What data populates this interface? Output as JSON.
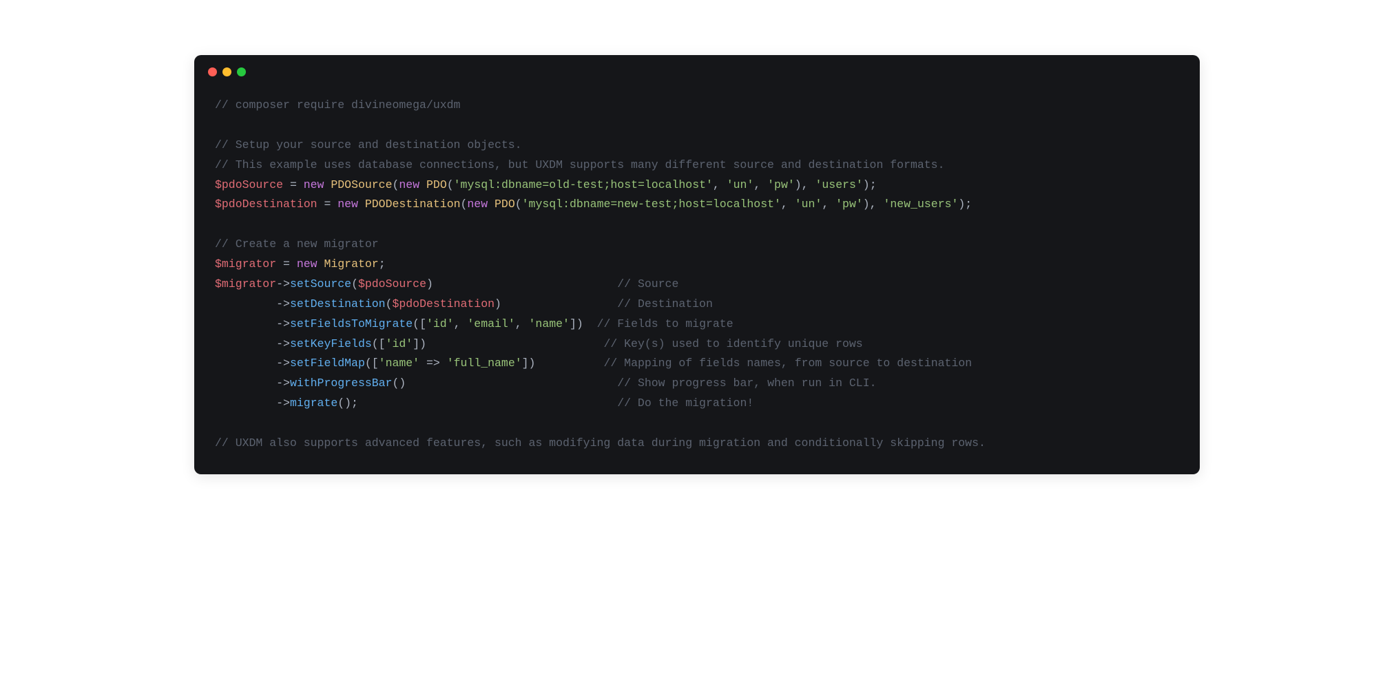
{
  "window": {
    "controls": {
      "red": "#ff5f56",
      "yellow": "#ffbd2e",
      "green": "#27c93f"
    }
  },
  "code": {
    "tokens": [
      {
        "type": "comment",
        "text": "// composer require divineomega/uxdm"
      },
      {
        "type": "newline",
        "text": "\n\n"
      },
      {
        "type": "comment",
        "text": "// Setup your source and destination objects."
      },
      {
        "type": "newline",
        "text": "\n"
      },
      {
        "type": "comment",
        "text": "// This example uses database connections, but UXDM supports many different source and destination formats."
      },
      {
        "type": "newline",
        "text": "\n"
      },
      {
        "type": "variable",
        "text": "$pdoSource"
      },
      {
        "type": "punct",
        "text": " "
      },
      {
        "type": "operator",
        "text": "="
      },
      {
        "type": "punct",
        "text": " "
      },
      {
        "type": "keyword",
        "text": "new"
      },
      {
        "type": "punct",
        "text": " "
      },
      {
        "type": "class-name",
        "text": "PDOSource"
      },
      {
        "type": "punct",
        "text": "("
      },
      {
        "type": "keyword",
        "text": "new"
      },
      {
        "type": "punct",
        "text": " "
      },
      {
        "type": "class-name",
        "text": "PDO"
      },
      {
        "type": "punct",
        "text": "("
      },
      {
        "type": "string",
        "text": "'mysql:dbname=old-test;host=localhost'"
      },
      {
        "type": "punct",
        "text": ", "
      },
      {
        "type": "string",
        "text": "'un'"
      },
      {
        "type": "punct",
        "text": ", "
      },
      {
        "type": "string",
        "text": "'pw'"
      },
      {
        "type": "punct",
        "text": "), "
      },
      {
        "type": "string",
        "text": "'users'"
      },
      {
        "type": "punct",
        "text": ");"
      },
      {
        "type": "newline",
        "text": "\n"
      },
      {
        "type": "variable",
        "text": "$pdoDestination"
      },
      {
        "type": "punct",
        "text": " "
      },
      {
        "type": "operator",
        "text": "="
      },
      {
        "type": "punct",
        "text": " "
      },
      {
        "type": "keyword",
        "text": "new"
      },
      {
        "type": "punct",
        "text": " "
      },
      {
        "type": "class-name",
        "text": "PDODestination"
      },
      {
        "type": "punct",
        "text": "("
      },
      {
        "type": "keyword",
        "text": "new"
      },
      {
        "type": "punct",
        "text": " "
      },
      {
        "type": "class-name",
        "text": "PDO"
      },
      {
        "type": "punct",
        "text": "("
      },
      {
        "type": "string",
        "text": "'mysql:dbname=new-test;host=localhost'"
      },
      {
        "type": "punct",
        "text": ", "
      },
      {
        "type": "string",
        "text": "'un'"
      },
      {
        "type": "punct",
        "text": ", "
      },
      {
        "type": "string",
        "text": "'pw'"
      },
      {
        "type": "punct",
        "text": "), "
      },
      {
        "type": "string",
        "text": "'new_users'"
      },
      {
        "type": "punct",
        "text": ");"
      },
      {
        "type": "newline",
        "text": "\n\n"
      },
      {
        "type": "comment",
        "text": "// Create a new migrator"
      },
      {
        "type": "newline",
        "text": "\n"
      },
      {
        "type": "variable",
        "text": "$migrator"
      },
      {
        "type": "punct",
        "text": " "
      },
      {
        "type": "operator",
        "text": "="
      },
      {
        "type": "punct",
        "text": " "
      },
      {
        "type": "keyword",
        "text": "new"
      },
      {
        "type": "punct",
        "text": " "
      },
      {
        "type": "class-name",
        "text": "Migrator"
      },
      {
        "type": "punct",
        "text": ";"
      },
      {
        "type": "newline",
        "text": "\n"
      },
      {
        "type": "variable",
        "text": "$migrator"
      },
      {
        "type": "operator",
        "text": "->"
      },
      {
        "type": "function",
        "text": "setSource"
      },
      {
        "type": "punct",
        "text": "("
      },
      {
        "type": "variable",
        "text": "$pdoSource"
      },
      {
        "type": "punct",
        "text": ")                           "
      },
      {
        "type": "comment",
        "text": "// Source"
      },
      {
        "type": "newline",
        "text": "\n"
      },
      {
        "type": "punct",
        "text": "         "
      },
      {
        "type": "operator",
        "text": "->"
      },
      {
        "type": "function",
        "text": "setDestination"
      },
      {
        "type": "punct",
        "text": "("
      },
      {
        "type": "variable",
        "text": "$pdoDestination"
      },
      {
        "type": "punct",
        "text": ")                 "
      },
      {
        "type": "comment",
        "text": "// Destination"
      },
      {
        "type": "newline",
        "text": "\n"
      },
      {
        "type": "punct",
        "text": "         "
      },
      {
        "type": "operator",
        "text": "->"
      },
      {
        "type": "function",
        "text": "setFieldsToMigrate"
      },
      {
        "type": "punct",
        "text": "(["
      },
      {
        "type": "string",
        "text": "'id'"
      },
      {
        "type": "punct",
        "text": ", "
      },
      {
        "type": "string",
        "text": "'email'"
      },
      {
        "type": "punct",
        "text": ", "
      },
      {
        "type": "string",
        "text": "'name'"
      },
      {
        "type": "punct",
        "text": "])  "
      },
      {
        "type": "comment",
        "text": "// Fields to migrate"
      },
      {
        "type": "newline",
        "text": "\n"
      },
      {
        "type": "punct",
        "text": "         "
      },
      {
        "type": "operator",
        "text": "->"
      },
      {
        "type": "function",
        "text": "setKeyFields"
      },
      {
        "type": "punct",
        "text": "(["
      },
      {
        "type": "string",
        "text": "'id'"
      },
      {
        "type": "punct",
        "text": "])                          "
      },
      {
        "type": "comment",
        "text": "// Key(s) used to identify unique rows"
      },
      {
        "type": "newline",
        "text": "\n"
      },
      {
        "type": "punct",
        "text": "         "
      },
      {
        "type": "operator",
        "text": "->"
      },
      {
        "type": "function",
        "text": "setFieldMap"
      },
      {
        "type": "punct",
        "text": "(["
      },
      {
        "type": "string",
        "text": "'name'"
      },
      {
        "type": "punct",
        "text": " "
      },
      {
        "type": "operator",
        "text": "=>"
      },
      {
        "type": "punct",
        "text": " "
      },
      {
        "type": "string",
        "text": "'full_name'"
      },
      {
        "type": "punct",
        "text": "])          "
      },
      {
        "type": "comment",
        "text": "// Mapping of fields names, from source to destination"
      },
      {
        "type": "newline",
        "text": "\n"
      },
      {
        "type": "punct",
        "text": "         "
      },
      {
        "type": "operator",
        "text": "->"
      },
      {
        "type": "function",
        "text": "withProgressBar"
      },
      {
        "type": "punct",
        "text": "()                               "
      },
      {
        "type": "comment",
        "text": "// Show progress bar, when run in CLI."
      },
      {
        "type": "newline",
        "text": "\n"
      },
      {
        "type": "punct",
        "text": "         "
      },
      {
        "type": "operator",
        "text": "->"
      },
      {
        "type": "function",
        "text": "migrate"
      },
      {
        "type": "punct",
        "text": "();                                      "
      },
      {
        "type": "comment",
        "text": "// Do the migration!"
      },
      {
        "type": "newline",
        "text": "\n\n"
      },
      {
        "type": "comment",
        "text": "// UXDM also supports advanced features, such as modifying data during migration and conditionally skipping rows."
      }
    ]
  }
}
